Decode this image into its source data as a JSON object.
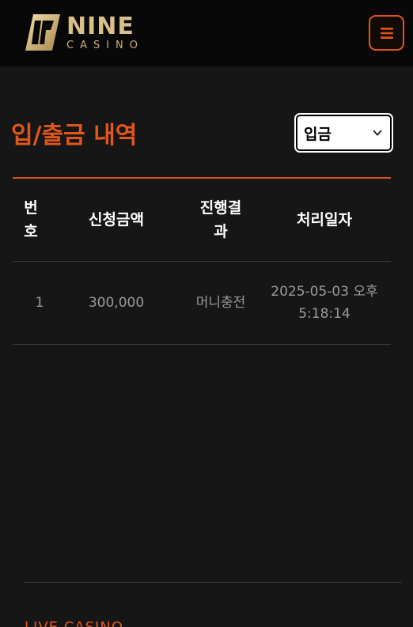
{
  "header": {
    "logo_primary": "NINE",
    "logo_secondary": "CASINO",
    "menu_icon": "hamburger-icon",
    "accent_color": "#e2561a",
    "logo_color": "#d9c08a"
  },
  "page": {
    "title": "입/출금 내역",
    "type_filter": {
      "selected": "입금"
    }
  },
  "table": {
    "columns": {
      "no": "번호",
      "amount": "신청금액",
      "result": "진행결과",
      "date": "처리일자"
    },
    "no_lines": [
      "번",
      "호"
    ],
    "result_lines": [
      "진행결",
      "과"
    ],
    "rows": [
      {
        "no": "1",
        "amount": "300,000",
        "result": "머니충전",
        "date_line1": "2025-05-03 오후",
        "date_line2": "5:18:14"
      }
    ]
  },
  "footer": {
    "section_title": "LIVE CASINO"
  }
}
